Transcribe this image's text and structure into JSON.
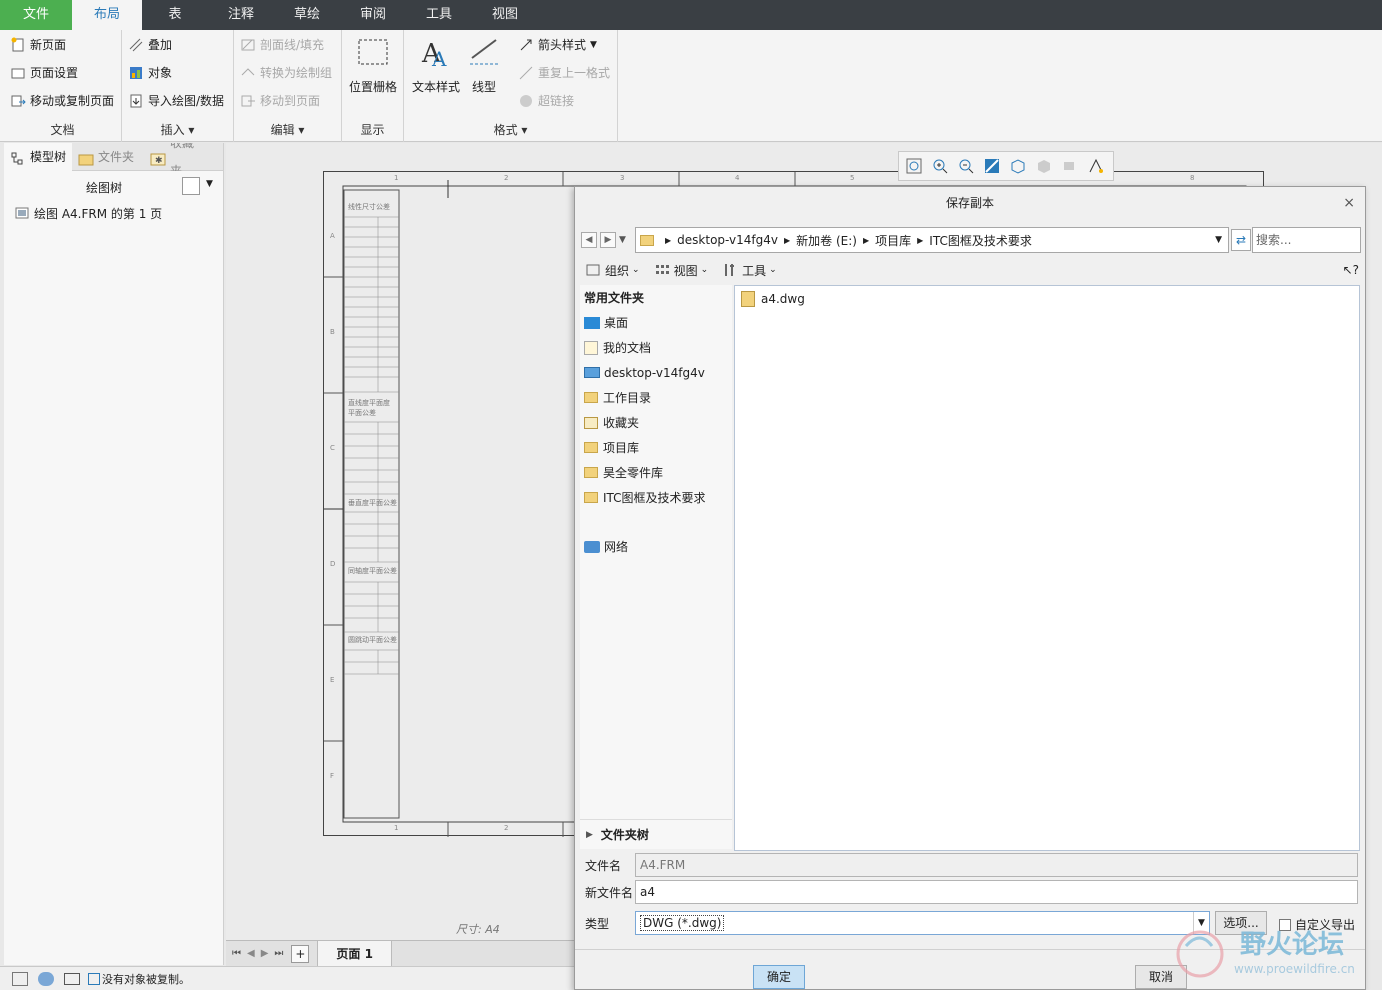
{
  "menu": {
    "tabs": [
      "文件",
      "布局",
      "表",
      "注释",
      "草绘",
      "审阅",
      "工具",
      "视图"
    ],
    "active": "布局"
  },
  "ribbon": {
    "doc": {
      "title": "文档",
      "items": [
        "新页面",
        "页面设置",
        "移动或复制页面"
      ]
    },
    "insert": {
      "title": "插入",
      "items": [
        "叠加",
        "对象",
        "导入绘图/数据"
      ]
    },
    "edit": {
      "title": "编辑",
      "items": [
        "剖面线/填充",
        "转换为绘制组",
        "移动到页面"
      ]
    },
    "display": {
      "title": "显示",
      "btn": "位置栅格"
    },
    "format": {
      "title": "格式",
      "text_style": "文本样式",
      "line_type": "线型",
      "items": [
        "箭头样式",
        "重复上一格式",
        "超链接"
      ]
    }
  },
  "left_panel": {
    "tabs": [
      "模型树",
      "文件夹",
      "收藏夹"
    ],
    "header": "绘图树",
    "item": "绘图 A4.FRM 的第 1 页"
  },
  "sheet": {
    "size_label": "尺寸:  A4",
    "col_numbers": [
      "1",
      "2",
      "3",
      "4",
      "5",
      "6",
      "7",
      "8"
    ],
    "row_letters": [
      "A",
      "B",
      "C",
      "D",
      "E",
      "F"
    ],
    "table_headers": [
      "线性尺寸公差",
      "直线度平面度 平面公差",
      "垂直度平面公差",
      "同轴度平面公差",
      "圆跳动平面公差"
    ]
  },
  "page_tabs": {
    "label": "页面 1",
    "add": "+"
  },
  "status": {
    "message": "没有对象被复制。"
  },
  "dialog": {
    "title": "保存副本",
    "close": "×",
    "breadcrumb": [
      "desktop-v14fg4v",
      "新加卷 (E:)",
      "项目库",
      "ITC图框及技术要求"
    ],
    "search_placeholder": "搜索...",
    "toolbar": [
      "组织",
      "视图",
      "工具"
    ],
    "help": "?",
    "nav_header": "常用文件夹",
    "nav_items": [
      "桌面",
      "我的文档",
      "desktop-v14fg4v",
      "工作目录",
      "收藏夹",
      "项目库",
      "昊全零件库",
      "ITC图框及技术要求"
    ],
    "nav_network": "网络",
    "folder_tree": "文件夹树",
    "files": [
      "a4.dwg"
    ],
    "file_name_label": "文件名",
    "file_name_value": "A4.FRM",
    "new_name_label": "新文件名",
    "new_name_value": "a4",
    "type_label": "类型",
    "type_value": "DWG (*.dwg)",
    "options_btn": "选项...",
    "custom_export": "自定义导出",
    "ok": "确定",
    "cancel": "取消"
  },
  "watermark": {
    "cn": "野火论坛",
    "url": "www.proewildfire.cn"
  }
}
